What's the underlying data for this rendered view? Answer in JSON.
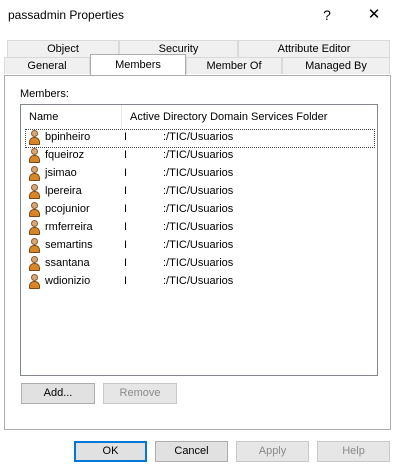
{
  "window": {
    "title": "passadmin Properties",
    "help_glyph": "?",
    "close_glyph": "✕"
  },
  "tabs": {
    "row_back": [
      "Object",
      "Security",
      "Attribute Editor"
    ],
    "row_front": [
      "General",
      "Members",
      "Member Of",
      "Managed By"
    ],
    "active": "Members"
  },
  "members": {
    "label": "Members:",
    "columns": [
      "Name",
      "Active Directory Domain Services Folder"
    ],
    "rows": [
      {
        "name": "bpinheiro",
        "folder_prefix": "I",
        "folder": ":/TIC/Usuarios",
        "selected": true
      },
      {
        "name": "fqueiroz",
        "folder_prefix": "I",
        "folder": ":/TIC/Usuarios"
      },
      {
        "name": "jsimao",
        "folder_prefix": "I",
        "folder": ":/TIC/Usuarios"
      },
      {
        "name": "lpereira",
        "folder_prefix": "I",
        "folder": ":/TIC/Usuarios"
      },
      {
        "name": "pcojunior",
        "folder_prefix": "I",
        "folder": ":/TIC/Usuarios"
      },
      {
        "name": "rmferreira",
        "folder_prefix": "I",
        "folder": ":/TIC/Usuarios"
      },
      {
        "name": "semartins",
        "folder_prefix": "I",
        "folder": ":/TIC/Usuarios"
      },
      {
        "name": "ssantana",
        "folder_prefix": "I",
        "folder": ":/TIC/Usuarios"
      },
      {
        "name": "wdionizio",
        "folder_prefix": "I",
        "folder": ":/TIC/Usuarios"
      }
    ],
    "row_icon": "user-icon"
  },
  "actions": {
    "add": "Add...",
    "remove": "Remove"
  },
  "footer": {
    "ok": "OK",
    "cancel": "Cancel",
    "apply": "Apply",
    "help": "Help"
  }
}
